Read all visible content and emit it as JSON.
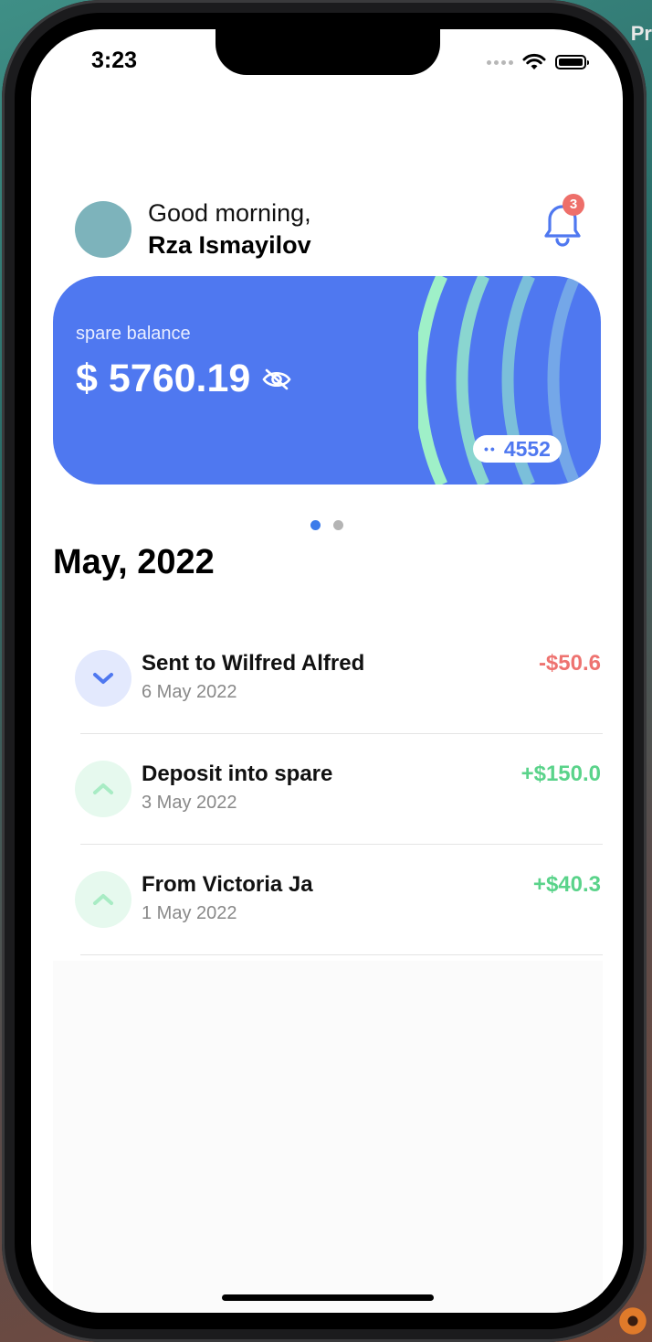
{
  "status_bar": {
    "time": "3:23"
  },
  "header": {
    "greeting": "Good morning,",
    "user_name": "Rza Ismayilov",
    "notification_count": "3"
  },
  "card": {
    "label": "spare balance",
    "amount": "$ 5760.19",
    "card_number_mask": "••",
    "card_last4": "4552"
  },
  "pager": {
    "total": 2,
    "active": 1
  },
  "month_title": "May, 2022",
  "transactions": [
    {
      "name": "Sent to Wilfred Alfred",
      "date": "6 May 2022",
      "amount": "-$50.6",
      "direction": "down"
    },
    {
      "name": "Deposit into spare",
      "date": "3 May 2022",
      "amount": "+$150.0",
      "direction": "up"
    },
    {
      "name": "From Victoria Ja",
      "date": "1 May 2022",
      "amount": "+$40.3",
      "direction": "up"
    }
  ],
  "colors": {
    "card": "#4f78f0",
    "negative": "#ee7370",
    "positive": "#5ad38a",
    "badge": "#ee6f6a"
  }
}
